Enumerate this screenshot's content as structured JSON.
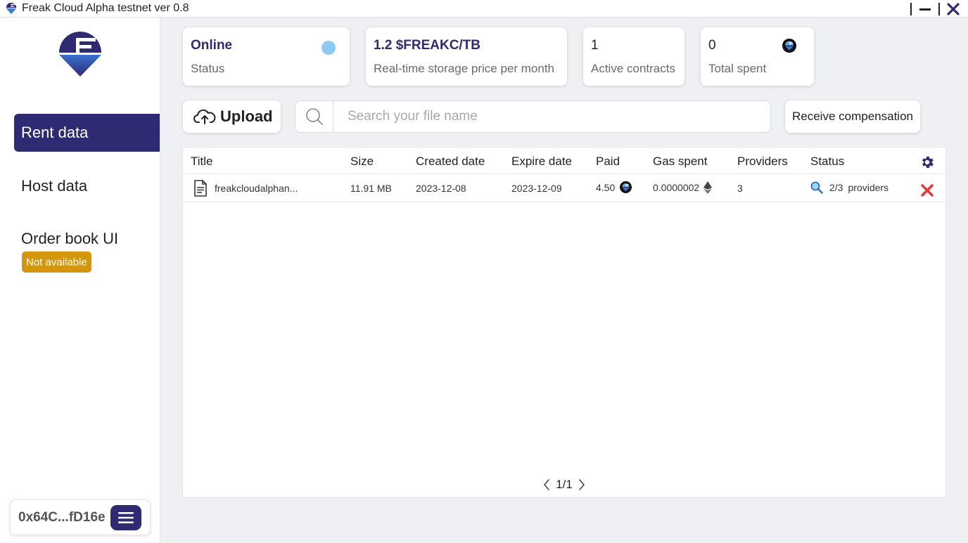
{
  "window": {
    "title": "Freak Cloud Alpha testnet ver 0.8"
  },
  "sidebar": {
    "items": [
      {
        "label": "Rent data"
      },
      {
        "label": "Host data"
      },
      {
        "label": "Order book UI"
      }
    ],
    "order_book_badge": "Not available",
    "wallet_address": "0x64C...fD16e"
  },
  "stats": {
    "status": {
      "value": "Online",
      "label": "Status"
    },
    "price": {
      "value": "1.2 $FREAKC/TB",
      "label": "Real-time storage price per month"
    },
    "contracts": {
      "value": "1",
      "label": "Active contracts"
    },
    "spent": {
      "value": "0",
      "label": "Total spent"
    }
  },
  "actions": {
    "upload_label": "Upload",
    "search_placeholder": "Search your file name",
    "compensation_label": "Receive compensation"
  },
  "table": {
    "headers": [
      "Title",
      "Size",
      "Created date",
      "Expire date",
      "Paid",
      "Gas spent",
      "Providers",
      "Status"
    ],
    "rows": [
      {
        "title": "freakcloudalphan...",
        "size": "11.91 MB",
        "created": "2023-12-08",
        "expire": "2023-12-09",
        "paid": "4.50",
        "gas": "0.0000002",
        "providers": "3",
        "status_count": "2/3",
        "status_text": "providers"
      }
    ],
    "page": "1/1"
  },
  "colors": {
    "brand": "#2f2b72",
    "badge": "#d4960c",
    "online_dot": "#8ccaf3",
    "delete": "#e53935"
  },
  "icons": [
    "app-logo-icon",
    "minimize-icon",
    "close-icon",
    "cloud-upload-icon",
    "search-icon",
    "file-icon",
    "freak-coin-icon",
    "ethereum-icon",
    "magnifier-status-icon",
    "gear-icon",
    "delete-icon",
    "chevron-left-icon",
    "chevron-right-icon",
    "hamburger-menu-icon"
  ]
}
